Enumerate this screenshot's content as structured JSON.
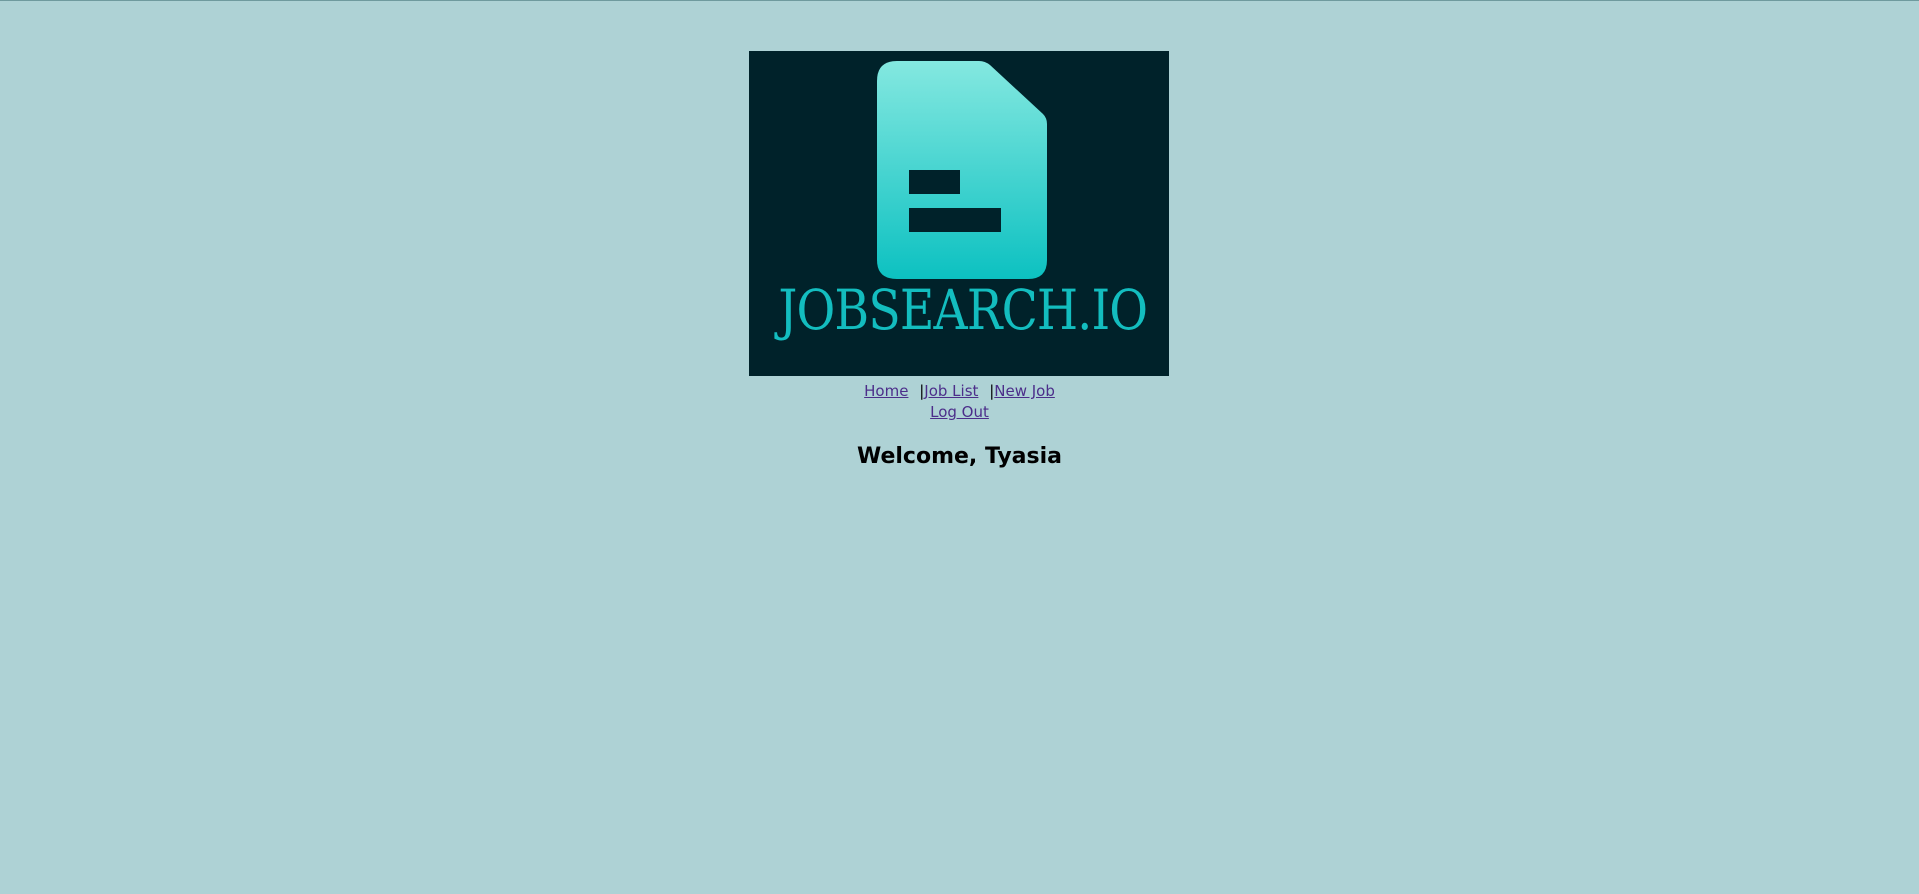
{
  "logo": {
    "text": "JOBSEARCH.IO",
    "icon": "document-icon",
    "background": "#00222a",
    "accent": "#13bdbf"
  },
  "nav": {
    "home": "Home",
    "job_list": "Job List",
    "new_job": "New Job",
    "log_out": "Log Out",
    "separator": "|"
  },
  "welcome": "Welcome, Tyasia",
  "colors": {
    "page_background": "#aed2d5",
    "link": "#4c2e8a"
  }
}
